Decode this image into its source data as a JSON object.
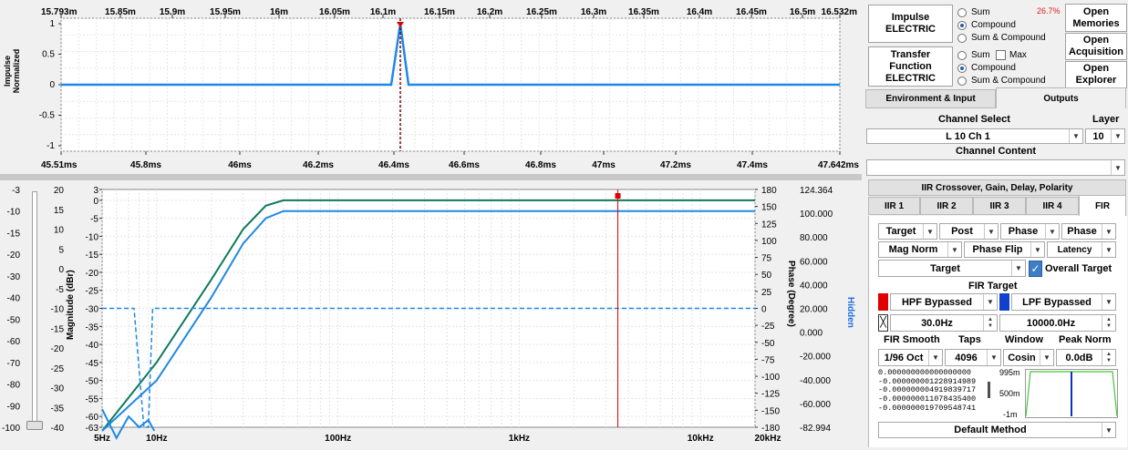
{
  "impulse_chart": {
    "top_ticks": [
      "15.793m",
      "15.85m",
      "15.9m",
      "15.95m",
      "16m",
      "16.05m",
      "16.1m",
      "16.15m",
      "16.2m",
      "16.25m",
      "16.3m",
      "16.35m",
      "16.4m",
      "16.45m",
      "16.5m",
      "16.532m"
    ],
    "bottom_ticks": [
      "45.51ms",
      "45.8ms",
      "46ms",
      "46.2ms",
      "46.4ms",
      "46.6ms",
      "46.8ms",
      "47ms",
      "47.2ms",
      "47.4ms",
      "47.642ms"
    ],
    "y_ticks": [
      "1",
      "0.5",
      "0",
      "-0.5",
      "-1"
    ],
    "ylabel_1": "Impulse",
    "ylabel_2": "Normalized",
    "color": "#1e88e5"
  },
  "freq_chart": {
    "left_outer_ticks": [
      "-3",
      "-10",
      "-15",
      "-20",
      "-30",
      "-40",
      "-50",
      "-60",
      "-70",
      "-80",
      "-90",
      "-100"
    ],
    "left_inner_ticks": [
      "20",
      "15",
      "10",
      "5",
      "0",
      "-5",
      "-10",
      "-15",
      "-20",
      "-25",
      "-30",
      "-35",
      "-40"
    ],
    "mag_ticks": [
      "3",
      "0",
      "-5",
      "-10",
      "-15",
      "-20",
      "-25",
      "-30",
      "-35",
      "-40",
      "-45",
      "-50",
      "-55",
      "-60",
      "-63"
    ],
    "phase_ticks": [
      "180",
      "150",
      "125",
      "100",
      "75",
      "50",
      "25",
      "0",
      "-25",
      "-50",
      "-75",
      "-100",
      "-125",
      "-150",
      "-180"
    ],
    "right_ticks": [
      "124.364",
      "100.000",
      "80.000",
      "60.000",
      "40.000",
      "20.000",
      "0.000",
      "-20.000",
      "-40.000",
      "-60.000",
      "-82.994"
    ],
    "x_ticks": [
      "5Hz",
      "10Hz",
      "100Hz",
      "1kHz",
      "10kHz",
      "20kHz"
    ],
    "ylabel_mag": "Magnitude (dBr)",
    "ylabel_phase": "Phase (Degree)",
    "hidden_label": "Hidden",
    "chart_data": {
      "type": "line",
      "xlabel": "",
      "ylabel": "Magnitude (dBr)",
      "x_scale": "log",
      "xlim": [
        5,
        20000
      ],
      "ylim": [
        -63,
        3
      ],
      "series": [
        {
          "color": "#0f7a5e",
          "x": [
            5,
            10,
            20,
            30,
            40,
            50,
            100,
            1000,
            20000
          ],
          "values": [
            -65,
            -45,
            -22,
            -8,
            -1.5,
            0,
            0,
            0,
            0
          ]
        },
        {
          "color": "#1e88e5",
          "x": [
            5,
            10,
            20,
            30,
            40,
            50,
            100,
            1000,
            20000
          ],
          "values": [
            -68,
            -50,
            -27,
            -12,
            -5,
            -3,
            -3,
            -3,
            -3
          ]
        },
        {
          "color": "#1e88e5",
          "x": [
            5,
            7.5,
            8.5,
            9,
            9.5,
            10,
            20000
          ],
          "values": [
            -30,
            -30,
            -63,
            -63,
            -30,
            -30,
            -30
          ]
        }
      ]
    }
  },
  "right_panel": {
    "impulse_btn": "Impulse\nELECTRIC",
    "r_sum": "Sum",
    "r_compound": "Compound",
    "r_sum_compound": "Sum & Compound",
    "percent": "26.7%",
    "open_memories": "Open\nMemories",
    "transfer_btn": "Transfer\nFunction\nELECTRIC",
    "t_sum": "Sum",
    "t_max": "Max",
    "t_compound": "Compound",
    "t_sum_compound": "Sum & Compound",
    "open_acquisition": "Open\nAcquisition",
    "open_explorer": "Open\nExplorer",
    "tab_env": "Environment & Input",
    "tab_outputs": "Outputs",
    "channel_select": "Channel Select",
    "layer": "Layer",
    "channel_value": "L 10 Ch 1",
    "layer_value": "10",
    "channel_content": "Channel Content",
    "iir_header": "IIR Crossover, Gain, Delay, Polarity",
    "tabs": [
      "IIR 1",
      "IIR 2",
      "IIR 3",
      "IIR 4",
      "FIR"
    ],
    "row1": [
      "Target",
      "Post",
      "Phase",
      "Phase"
    ],
    "row2": [
      "Mag Norm",
      "Phase Flip",
      "Latency"
    ],
    "target": "Target",
    "overall_target": "Overall Target",
    "fir_target": "FIR Target",
    "hpf": "HPF Bypassed",
    "lpf": "LPF Bypassed",
    "hpf_freq": "30.0Hz",
    "lpf_freq": "10000.0Hz",
    "fir_smooth": "FIR Smooth",
    "taps": "Taps",
    "window": "Window",
    "peak_norm": "Peak Norm",
    "smooth_val": "1/96 Oct",
    "taps_val": "4096",
    "window_val": "Cosin",
    "peak_val": "0.0dB",
    "coeffs": [
      "0.000000000000000000",
      "-0.000000001228914989",
      "-0.000000004919839717",
      "-0.000000011078435400",
      "-0.000000019709548741"
    ],
    "mini_ticks": [
      "995m",
      "500m",
      "-1m"
    ],
    "default_method": "Default Method",
    "hpf_color": "#e00000",
    "lpf_color": "#1040d0"
  }
}
